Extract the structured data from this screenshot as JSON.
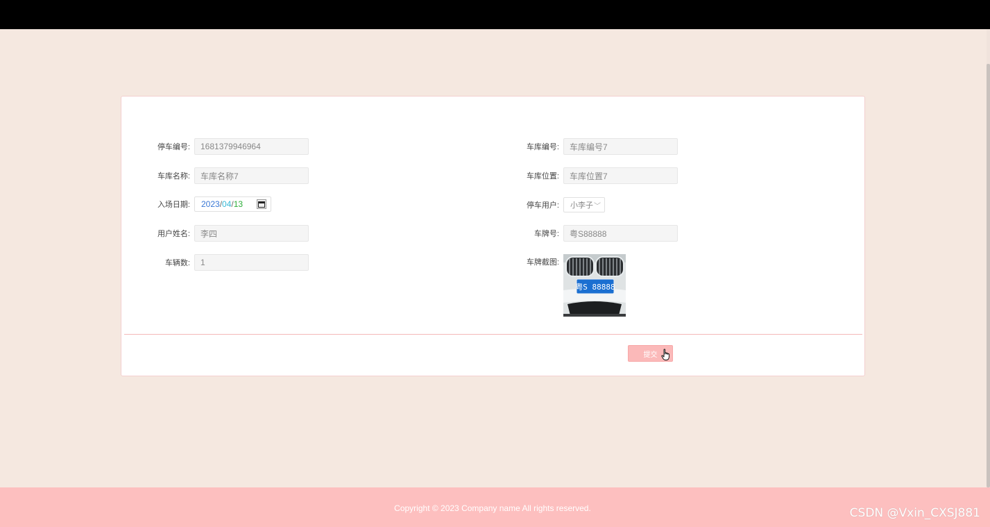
{
  "form": {
    "parking_no": {
      "label": "停车编号:",
      "value": "1681379946964"
    },
    "garage_no": {
      "label": "车库编号:",
      "value": "车库编号7"
    },
    "garage_name": {
      "label": "车库名称:",
      "value": "车库名称7"
    },
    "garage_location": {
      "label": "车库位置:",
      "value": "车库位置7"
    },
    "entry_date": {
      "label": "入场日期:",
      "year": "2023",
      "month": "04",
      "day": "13",
      "sep": "/"
    },
    "parking_user": {
      "label": "停车用户:",
      "value": "小李子"
    },
    "user_name": {
      "label": "用户姓名:",
      "value": "李四"
    },
    "plate_no": {
      "label": "车牌号:",
      "value": "粤S88888"
    },
    "vehicle_count": {
      "label": "车辆数:",
      "value": "1"
    },
    "plate_image": {
      "label": "车牌截图:",
      "plate_text": "粤S 88888"
    },
    "submit_label": "提交"
  },
  "footer": {
    "copyright": "Copyright © 2023 Company name All rights reserved."
  },
  "watermark": "CSDN @Vxin_CXSJ881",
  "colors": {
    "topbar": "#000000",
    "page_bg": "#f5e8e0",
    "footer_bg": "#fdbfbf",
    "submit_bg": "#fbb9b9",
    "divider": "#f4b8b8",
    "date_year": "#3a78d6",
    "date_month": "#37b8d6",
    "date_day": "#2eae3a"
  },
  "icons": [
    "calendar-icon",
    "chevron-down-icon",
    "hand-cursor-icon"
  ]
}
